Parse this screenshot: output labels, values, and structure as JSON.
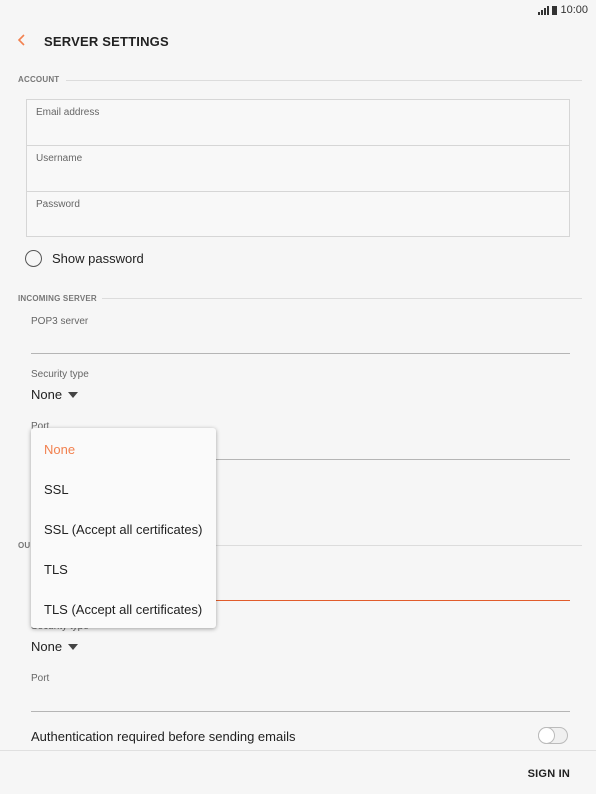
{
  "status": {
    "time": "10:00"
  },
  "header": {
    "title": "SERVER SETTINGS"
  },
  "account": {
    "section_title": "ACCOUNT",
    "fields": [
      "Email address",
      "Username",
      "Password"
    ],
    "show_password_label": "Show password"
  },
  "incoming": {
    "section_title": "INCOMING SERVER",
    "server_label": "POP3 server",
    "security_label": "Security type",
    "security_value": "None",
    "port_label": "Port"
  },
  "outgoing": {
    "section_title_partial": "OU",
    "security_label": "Security type",
    "security_value": "None",
    "port_label": "Port",
    "auth_label": "Authentication required before sending emails"
  },
  "security_dropdown": {
    "options": [
      "None",
      "SSL",
      "SSL (Accept all certificates)",
      "TLS",
      "TLS (Accept all certificates)"
    ],
    "selected": "None"
  },
  "footer": {
    "sign_in": "SIGN IN"
  },
  "colors": {
    "accent": "#f2814f",
    "active_underline": "#e15c2b"
  }
}
